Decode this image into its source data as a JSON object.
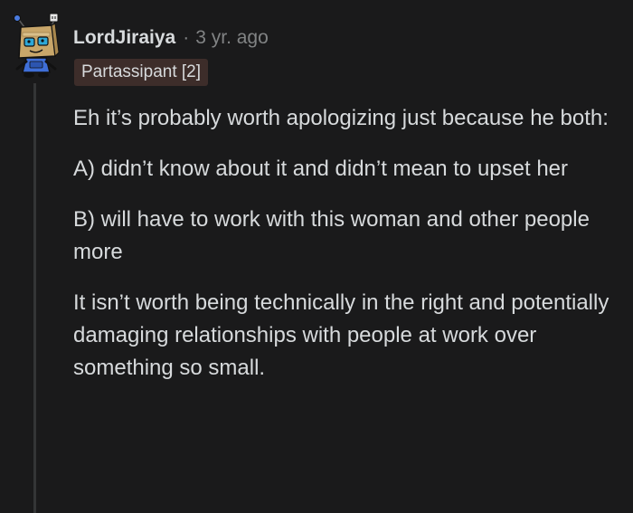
{
  "comment": {
    "author": "LordJiraiya",
    "separator": "·",
    "time_ago": "3 yr. ago",
    "flair": "Partassipant [2]",
    "paragraphs": [
      "Eh it’s probably worth apologizing just because he both:",
      "A) didn’t know about it and didn’t mean to upset her",
      "B) will have to work with this woman and other people more",
      "It isn’t worth being technically in the right and potentially damaging relationships with people at work over something so small."
    ]
  },
  "colors": {
    "background": "#1a1a1b",
    "text": "#d7dadc",
    "meta": "#818384",
    "flair_bg": "#3d2d2a",
    "thread_line": "#343536"
  },
  "icons": {
    "avatar": "snoo-box-head-robot-avatar"
  }
}
